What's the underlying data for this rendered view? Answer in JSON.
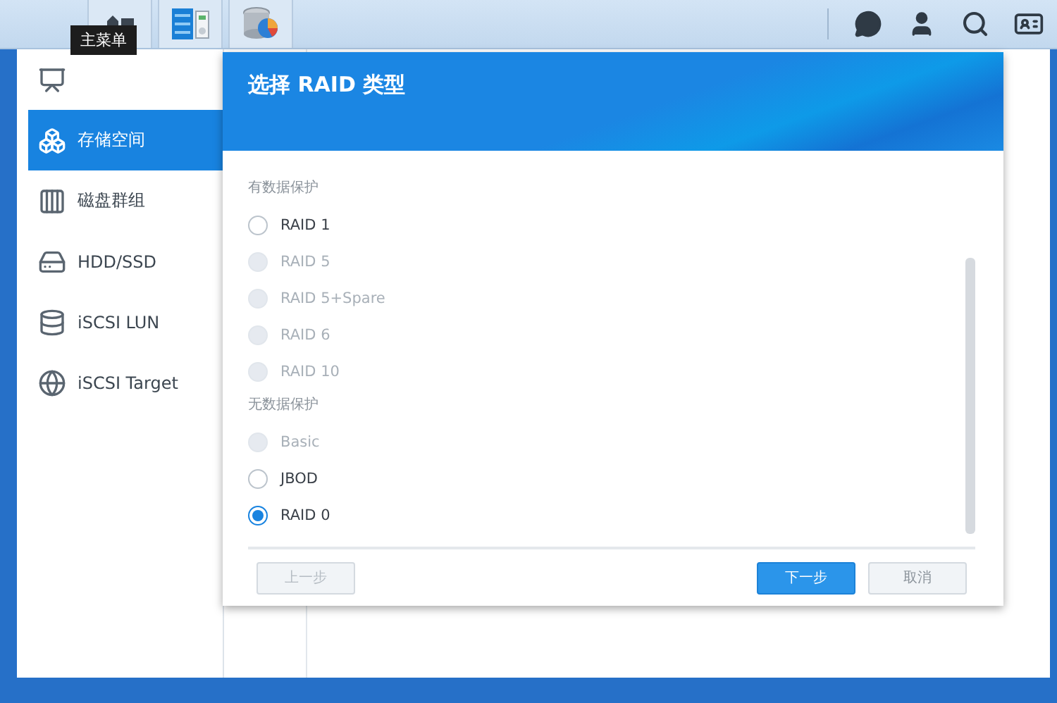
{
  "taskbar": {
    "tooltip": "主菜单",
    "apps": [
      {
        "kind": "home"
      },
      {
        "kind": "panel"
      },
      {
        "kind": "storage"
      }
    ],
    "tray": [
      {
        "kind": "chat"
      },
      {
        "kind": "user"
      },
      {
        "kind": "search"
      },
      {
        "kind": "widgets"
      }
    ]
  },
  "sidebar": {
    "items": [
      {
        "kind": "overview",
        "selected": false
      },
      {
        "kind": "volume",
        "label": "存储空间",
        "selected": true
      },
      {
        "kind": "group",
        "label": "磁盘群组",
        "selected": false
      },
      {
        "kind": "disk",
        "label": "HDD/SSD",
        "selected": false
      },
      {
        "kind": "lun",
        "label": "iSCSI LUN",
        "selected": false
      },
      {
        "kind": "target",
        "label": "iSCSI Target",
        "selected": false
      }
    ]
  },
  "dialog": {
    "title": "选择 RAID 类型",
    "groups": [
      {
        "label": "有数据保护",
        "options": [
          {
            "label": "RAID 1",
            "disabled": false,
            "selected": false
          },
          {
            "label": "RAID 5",
            "disabled": true,
            "selected": false
          },
          {
            "label": "RAID 5+Spare",
            "disabled": true,
            "selected": false
          },
          {
            "label": "RAID 6",
            "disabled": true,
            "selected": false
          },
          {
            "label": "RAID 10",
            "disabled": true,
            "selected": false
          }
        ]
      },
      {
        "label": "无数据保护",
        "options": [
          {
            "label": "Basic",
            "disabled": true,
            "selected": false
          },
          {
            "label": "JBOD",
            "disabled": false,
            "selected": false
          },
          {
            "label": "RAID 0",
            "disabled": false,
            "selected": true
          }
        ]
      }
    ],
    "buttons": [
      {
        "label": "上一步",
        "kind": "secondary",
        "disabled": true
      },
      {
        "label": "下一步",
        "kind": "primary",
        "disabled": false
      },
      {
        "label": "取消",
        "kind": "secondary",
        "disabled": false
      }
    ]
  }
}
